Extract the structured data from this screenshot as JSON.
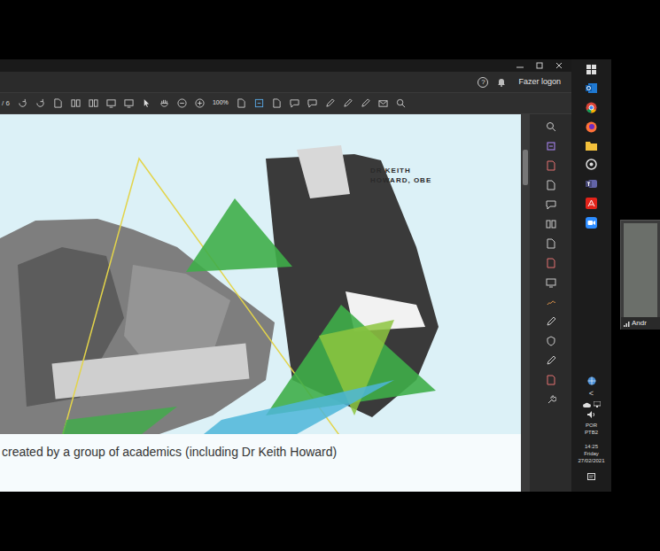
{
  "viewer": {
    "page_count": "/ 6",
    "help": "?",
    "sign_in": "Fazer logon",
    "zoom": "100%"
  },
  "slide": {
    "name_label": [
      "DR KEITH",
      "HOWARD, OBE"
    ],
    "caption": "created by a group of academics (including Dr Keith Howard)"
  },
  "taskbar": {
    "chevron": "<",
    "language": [
      "POR",
      "PTB2"
    ],
    "clock": [
      "14:25",
      "Friday",
      "27/02/2021"
    ]
  },
  "video_tile": {
    "name": "Andr"
  }
}
